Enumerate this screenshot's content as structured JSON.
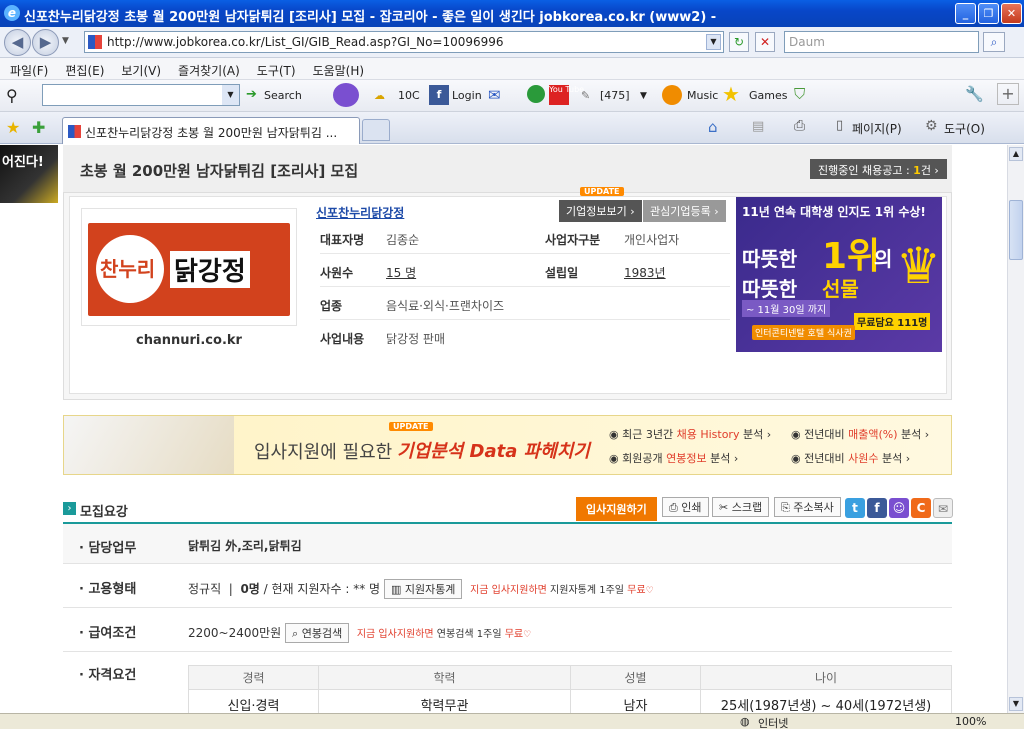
{
  "window": {
    "title": "신포찬누리닭강정 초봉 월 200만원 남자닭튀김 [조리사] 모집 - 잡코리아 - 좋은 일이 생긴다 jobkorea.co.kr (www2) -"
  },
  "addressbar": {
    "url": "http://www.jobkorea.co.kr/List_GI/GIB_Read.asp?GI_No=10096996",
    "search_placeholder": "Daum"
  },
  "menu": [
    "파일(F)",
    "편집(E)",
    "보기(V)",
    "즐겨찾기(A)",
    "도구(T)",
    "도움말(H)"
  ],
  "toolbar": {
    "search_label": "Search",
    "temp": "10C",
    "login": "Login",
    "count": "[475]",
    "music": "Music",
    "games": "Games"
  },
  "tabs": {
    "active_label": "신포찬누리닭강정 초봉 월 200만원 남자닭튀김 ...",
    "right_items": [
      "페이지(P)",
      "도구(O)"
    ]
  },
  "page": {
    "left_ad_text": "어진다!",
    "job_title": "초봉 월 200만원 남자닭튀김 [조리사] 모집",
    "ongoing_label": "진행중인 채용공고 : ",
    "ongoing_count": "1",
    "ongoing_unit": "건",
    "company": {
      "name": "신포찬누리닭강정",
      "logo_text_1": "찬누리",
      "logo_text_2": "닭강정",
      "domain": "channuri.co.kr",
      "update_badge": "UPDATE",
      "info_button": "기업정보보기",
      "fav_button": "관심기업등록",
      "ceo_label": "대표자명",
      "ceo": "김종순",
      "biz_type_label": "사업자구분",
      "biz_type": "개인사업자",
      "employees_label": "사원수",
      "employees": "15 명",
      "founded_label": "설립일",
      "founded": "1983년",
      "industry_label": "업종",
      "industry": "음식료·외식·프랜차이즈",
      "business_label": "사업내용",
      "business": "닭강정 판매"
    },
    "ad_right": {
      "line1": "11년 연속 대학생 인지도 1위 수상!",
      "line2a": "따뜻한",
      "line2b": "1위",
      "line2c": "의",
      "line3a": "따뜻한",
      "line3b": "선물",
      "line4": "~ 11월 30일 까지",
      "line5": "무료담요 111명",
      "line6": "인터콘티넨탈 호텔 식사권"
    },
    "banner": {
      "update_badge": "UPDATE",
      "text_a": "입사지원에 필요한 ",
      "text_b": "기업분석 Data 파헤치기",
      "item1a": "최근 3년간 ",
      "item1b": "채용 History",
      "item1c": " 분석",
      "item2a": "전년대비 ",
      "item2b": "매출액(%)",
      "item2c": " 분석",
      "item3a": "회원공개 ",
      "item3b": "연봉정보",
      "item3c": " 분석",
      "item4a": "전년대비 ",
      "item4b": "사원수",
      "item4c": " 분석"
    },
    "recruit": {
      "section_title": "모집요강",
      "apply_button": "입사지원하기",
      "print_button": "인쇄",
      "scrap_button": "스크랩",
      "address_button": "주소복사",
      "duty_label": "담당업무",
      "duty": "닭튀김 外,조리,닭튀김",
      "employ_label": "고용형태",
      "employ_type": "정규직",
      "employ_count": "0명",
      "employ_applicants": "/ 현재 지원자수 : ** 명",
      "stats_button": "지원자통계",
      "employ_promo_red": "지금 입사지원하면",
      "employ_promo_black": " 지원자통계 1주일 ",
      "employ_promo_free": "무료",
      "salary_label": "급여조건",
      "salary": "2200~2400만원",
      "salary_button": "연봉검색",
      "salary_promo_red": "지금 입사지원하면",
      "salary_promo_black": " 연봉검색 1주일 ",
      "salary_promo_free": "무료",
      "qual_label": "자격요건",
      "qual_headers": [
        "경력",
        "학력",
        "성별",
        "나이"
      ],
      "qual_values": [
        "신입·경력",
        "학력무관",
        "남자",
        "25세(1987년생) ~ 40세(1972년생)"
      ]
    }
  },
  "status": {
    "zone": "인터넷",
    "zoom": "100%"
  }
}
